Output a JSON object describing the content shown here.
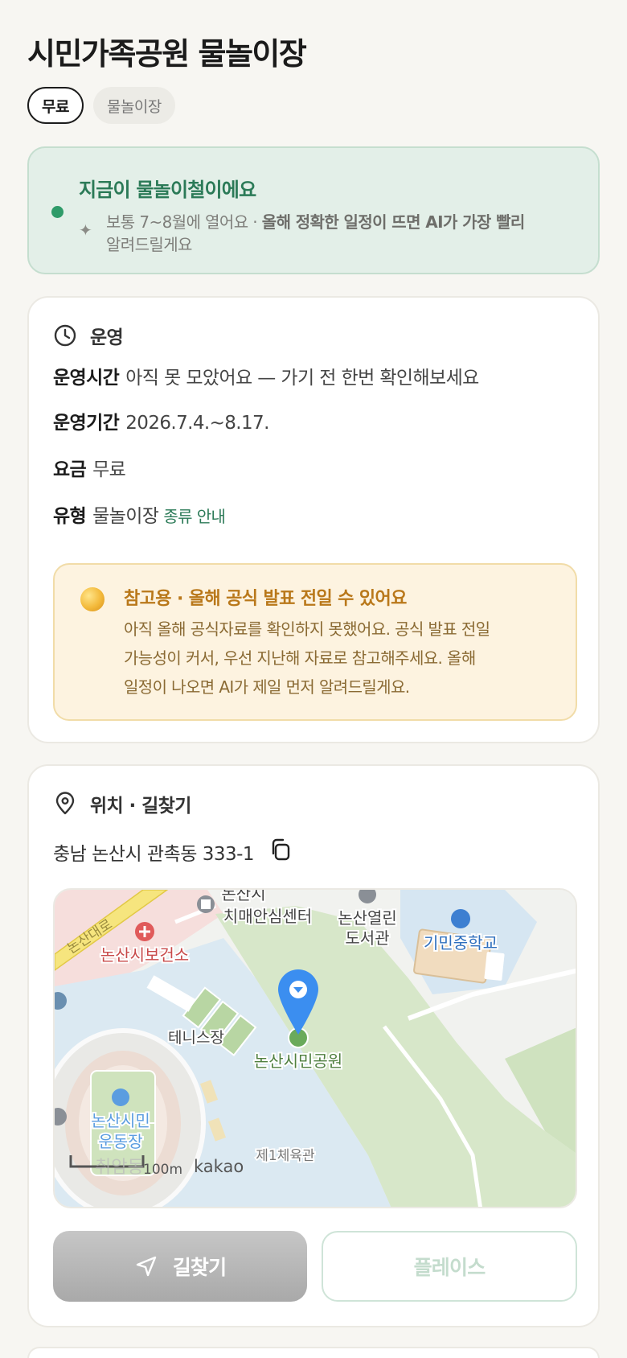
{
  "header": {
    "title": "시민가족공원 물놀이장",
    "tags": [
      "무료",
      "물놀이장"
    ]
  },
  "season_banner": {
    "title": "지금이 물놀이철이에요",
    "desc_plain": "보통 7~8월에 열어요 · ",
    "desc_bold": "올해 정확한 일정이 뜨면 AI가 가장 빨리",
    "desc_tail": "알려드릴게요",
    "icon": "sparkle-icon"
  },
  "operation": {
    "heading": "운영",
    "icon": "clock-icon",
    "rows": [
      {
        "key": "운영시간",
        "value": "아직 못 모았어요 — 가기 전 한번 확인해보세요"
      },
      {
        "key": "운영기간",
        "value": "2026.7.4.~8.17."
      },
      {
        "key": "요금",
        "value": "무료"
      },
      {
        "key": "유형",
        "value": "물놀이장",
        "link": "종류 안내"
      }
    ],
    "notice": {
      "title": "참고용 · 올해 공식 발표 전일 수 있어요",
      "lines": [
        "아직 올해 공식자료를 확인하지 못했어요. 공식 발표 전일",
        "가능성이 커서, 우선 지난해 자료로 참고해주세요. 올해",
        "일정이 나오면 AI가 제일 먼저 알려드릴게요."
      ],
      "icon": "coin-icon"
    }
  },
  "location": {
    "heading": "위치 · 길찾기",
    "icon": "pin-icon",
    "address": "충남 논산시 관촉동 333-1",
    "copy_icon": "copy-icon",
    "map": {
      "labels": {
        "road": "논산대로",
        "dementia_center_1": "논산시",
        "dementia_center_2": "치매안심센터",
        "library_1": "논산열린",
        "library_2": "도서관",
        "school": "기민중학교",
        "health_center": "논산시보건소",
        "tennis": "테니스장",
        "park": "논산시민공원",
        "stadium_1": "논산시민",
        "stadium_2": "운동장",
        "gym": "제1체육관",
        "scale": "100m",
        "provider": "kakao",
        "faded": "취암동"
      }
    },
    "buttons": {
      "route": "길찾기",
      "place": "플레이스"
    }
  },
  "colors": {
    "green": "#2b7a57",
    "season_bg": "#e3efe8",
    "notice_bg": "#fdf3e0",
    "notice_title": "#b9781a",
    "marker_blue": "#3b8ef0"
  }
}
